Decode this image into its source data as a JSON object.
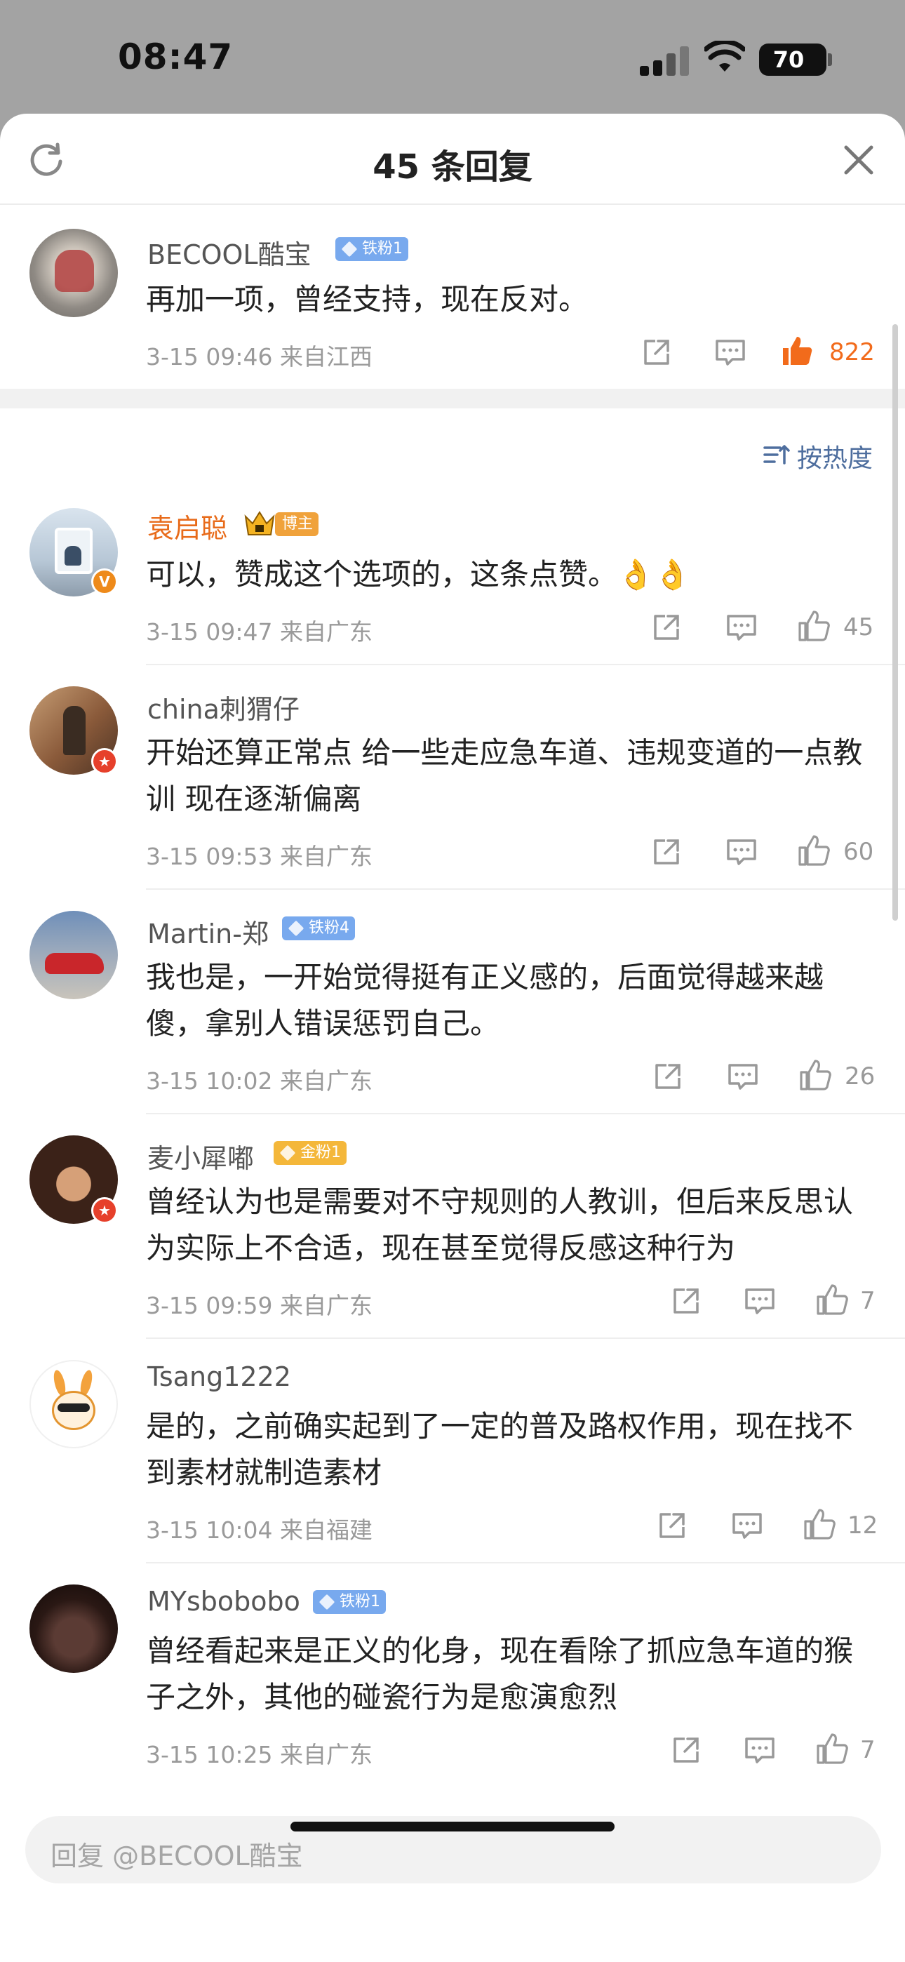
{
  "status_bar": {
    "time": "08:47",
    "battery": "70"
  },
  "header": {
    "title": "45 条回复"
  },
  "parent_comment": {
    "username": "BECOOL酷宝",
    "badge": "铁粉1",
    "text": "再加一项，曾经支持，现在反对。",
    "meta": "3-15 09:46  来自江西",
    "likes": "822",
    "liked": true
  },
  "sort_label": "按热度",
  "replies": [
    {
      "username": "袁启聪",
      "badge": "博主",
      "badge_type": "blogger",
      "verified": "V",
      "text": "可以，赞成这个选项的，这条点赞。👌👌",
      "meta": "3-15 09:47  来自广东",
      "likes": "45"
    },
    {
      "username": "china刺猬仔",
      "badge": "",
      "badge_type": "",
      "verified": "★",
      "text": "开始还算正常点  给一些走应急车道、违规变道的一点教训  现在逐渐偏离",
      "meta": "3-15 09:53  来自广东",
      "likes": "60"
    },
    {
      "username": "Martin-郑",
      "badge": "铁粉4",
      "badge_type": "iron",
      "verified": "",
      "text": "我也是，一开始觉得挺有正义感的，后面觉得越来越傻，拿别人错误惩罚自己。",
      "meta": "3-15 10:02  来自广东",
      "likes": "26"
    },
    {
      "username": "麦小犀嘟",
      "badge": "金粉1",
      "badge_type": "gold",
      "verified": "★",
      "text": "曾经认为也是需要对不守规则的人教训，但后来反思认为实际上不合适，现在甚至觉得反感这种行为",
      "meta": "3-15 09:59  来自广东",
      "likes": "7"
    },
    {
      "username": "Tsang1222",
      "badge": "",
      "badge_type": "",
      "verified": "",
      "text": "是的，之前确实起到了一定的普及路权作用，现在找不到素材就制造素材",
      "meta": "3-15 10:04  来自福建",
      "likes": "12"
    },
    {
      "username": "MYsbobobo",
      "badge": "铁粉1",
      "badge_type": "iron",
      "verified": "",
      "text": "曾经看起来是正义的化身，现在看除了抓应急车道的猴子之外，其他的碰瓷行为是愈演愈烈",
      "meta": "3-15 10:25  来自广东",
      "likes": "7"
    }
  ],
  "reply_input": {
    "placeholder": "回复 @BECOOL酷宝"
  },
  "colors": {
    "accent": "#f26b1b",
    "link": "#4e6e9e",
    "iron_badge": "#78a9ee",
    "gold_badge": "#f4b73a"
  }
}
